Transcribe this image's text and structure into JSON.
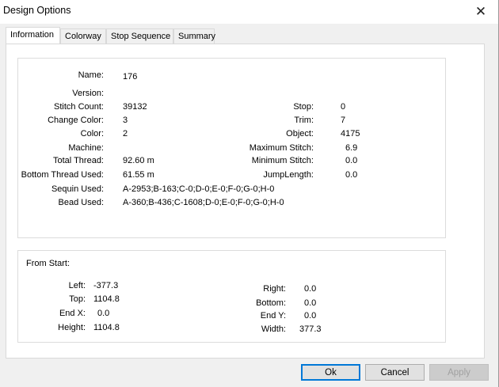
{
  "window": {
    "title": "Design Options",
    "close_glyph": "✕"
  },
  "tabs": [
    {
      "label": "Information",
      "active": true
    },
    {
      "label": "Colorway",
      "active": false
    },
    {
      "label": "Stop Sequence",
      "active": false
    },
    {
      "label": "Summary",
      "active": false
    }
  ],
  "info": {
    "name": {
      "label": "Name:",
      "value": "176"
    },
    "version": {
      "label": "Version:",
      "value": ""
    },
    "stitch_count": {
      "label": "Stitch Count:",
      "value": "39132"
    },
    "change_color": {
      "label": "Change Color:",
      "value": "3"
    },
    "color": {
      "label": "Color:",
      "value": "2"
    },
    "machine": {
      "label": "Machine:",
      "value": ""
    },
    "total_thread": {
      "label": "Total Thread:",
      "value": "92.60 m"
    },
    "bottom_thread_used": {
      "label": "Bottom Thread Used:",
      "value": "61.55 m"
    },
    "sequin_used": {
      "label": "Sequin Used:",
      "value": "A-2953;B-163;C-0;D-0;E-0;F-0;G-0;H-0"
    },
    "bead_used": {
      "label": "Bead Used:",
      "value": "A-360;B-436;C-1608;D-0;E-0;F-0;G-0;H-0"
    },
    "stop": {
      "label": "Stop:",
      "value": "0"
    },
    "trim": {
      "label": "Trim:",
      "value": "7"
    },
    "object": {
      "label": "Object:",
      "value": "4175"
    },
    "maximum_stitch": {
      "label": "Maximum Stitch:",
      "value": "6.9"
    },
    "minimum_stitch": {
      "label": "Minimum Stitch:",
      "value": "0.0"
    },
    "jump_length": {
      "label": "JumpLength:",
      "value": "0.0"
    }
  },
  "from_start": {
    "heading": "From Start:",
    "left": {
      "label": "Left:",
      "value": "-377.3"
    },
    "top": {
      "label": "Top:",
      "value": "1104.8"
    },
    "end_x": {
      "label": "End X:",
      "value": "0.0"
    },
    "height": {
      "label": "Height:",
      "value": "1104.8"
    },
    "right": {
      "label": "Right:",
      "value": "0.0"
    },
    "bottom": {
      "label": "Bottom:",
      "value": "0.0"
    },
    "end_y": {
      "label": "End Y:",
      "value": "0.0"
    },
    "width": {
      "label": "Width:",
      "value": "377.3"
    }
  },
  "buttons": {
    "ok": "Ok",
    "cancel": "Cancel",
    "apply": {
      "label": "Apply",
      "enabled": false
    }
  },
  "colors": {
    "focus_border": "#0078d7",
    "dialog_bg": "#f0f0f0",
    "panel_bg": "#ffffff"
  }
}
